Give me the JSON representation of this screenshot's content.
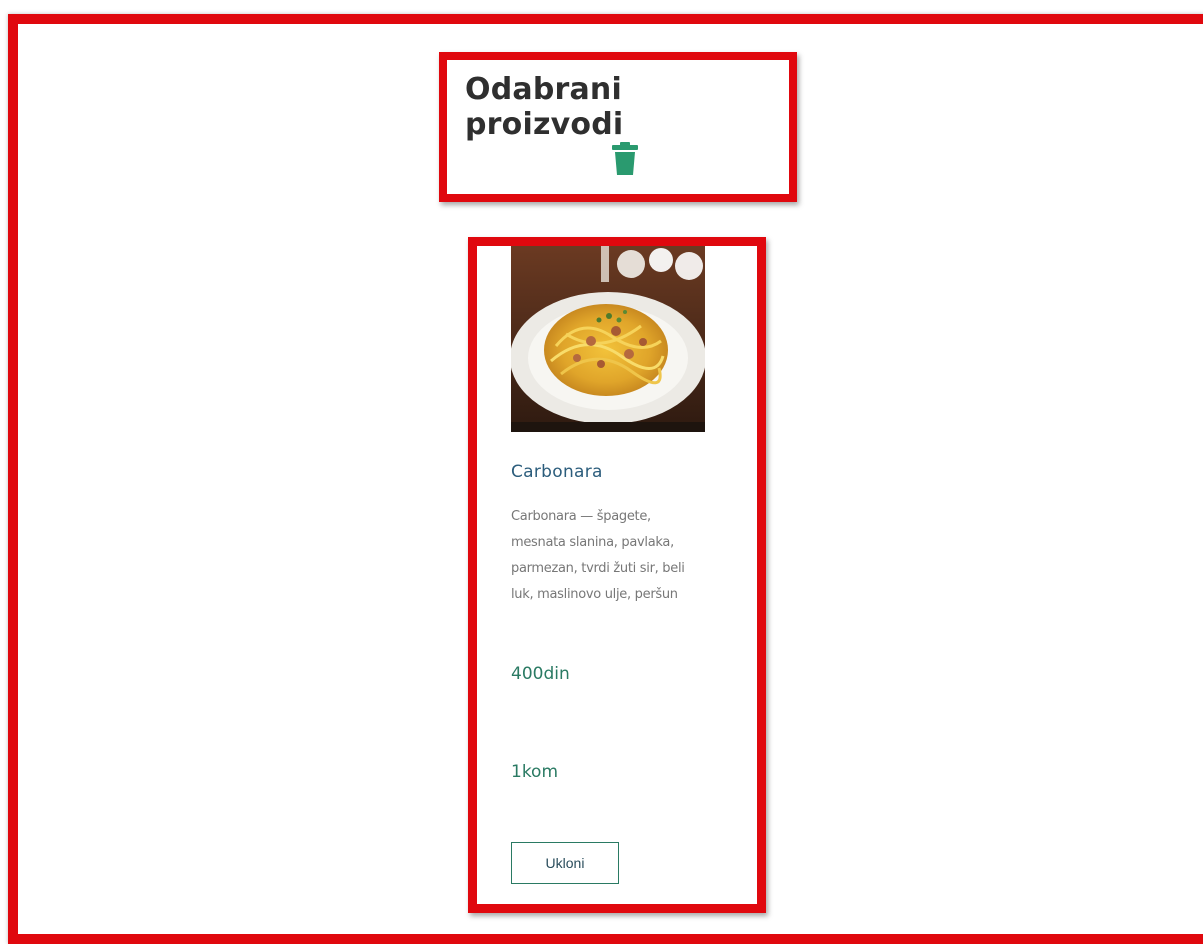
{
  "header": {
    "title": "Odabrani proizvodi",
    "clear_icon": "trash-icon"
  },
  "product": {
    "image_alt": "Carbonara",
    "name": "Carbonara",
    "description": "Carbonara — špagete, mesnata slanina, pavlaka, parmezan, tvrdi žuti sir, beli luk, maslinovo ulje, peršun",
    "price": "400din",
    "quantity": "1kom",
    "remove_label": "Ukloni"
  },
  "colors": {
    "highlight_border": "#e0080e",
    "accent_green": "#2a9a6f",
    "name_blue": "#2c5d7c"
  }
}
